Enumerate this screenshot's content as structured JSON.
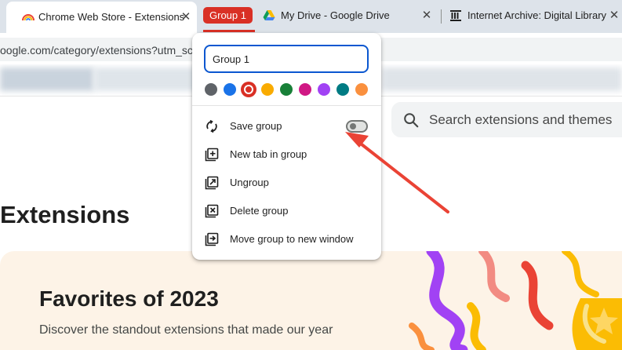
{
  "tabs": [
    {
      "title": "Chrome Web Store - Extensions",
      "close": "✕"
    },
    {
      "title": "My Drive - Google Drive",
      "close": "✕"
    },
    {
      "title": "Internet Archive: Digital Library",
      "close": "✕"
    }
  ],
  "tab_group": {
    "label": "Group 1",
    "color": "#d93025"
  },
  "address_bar": {
    "url": "oogle.com/category/extensions?utm_sc"
  },
  "popup": {
    "group_name_value": "Group 1",
    "colors": [
      "#5f6368",
      "#1a73e8",
      "#d93025",
      "#f9ab00",
      "#188038",
      "#d01884",
      "#a142f4",
      "#007b83",
      "#fa903e"
    ],
    "selected_color": "#d93025",
    "menu": {
      "save_group": "Save group",
      "new_tab_in_group": "New tab in group",
      "ungroup": "Ungroup",
      "delete_group": "Delete group",
      "move_group": "Move group to new window"
    },
    "save_group_toggle_on": false
  },
  "page": {
    "search_placeholder": "Search extensions and themes",
    "heading": "Extensions",
    "banner": {
      "title": "Favorites of 2023",
      "subtitle": "Discover the standout extensions that made our year"
    }
  },
  "annotation": {
    "arrow_color": "#ea4335"
  }
}
